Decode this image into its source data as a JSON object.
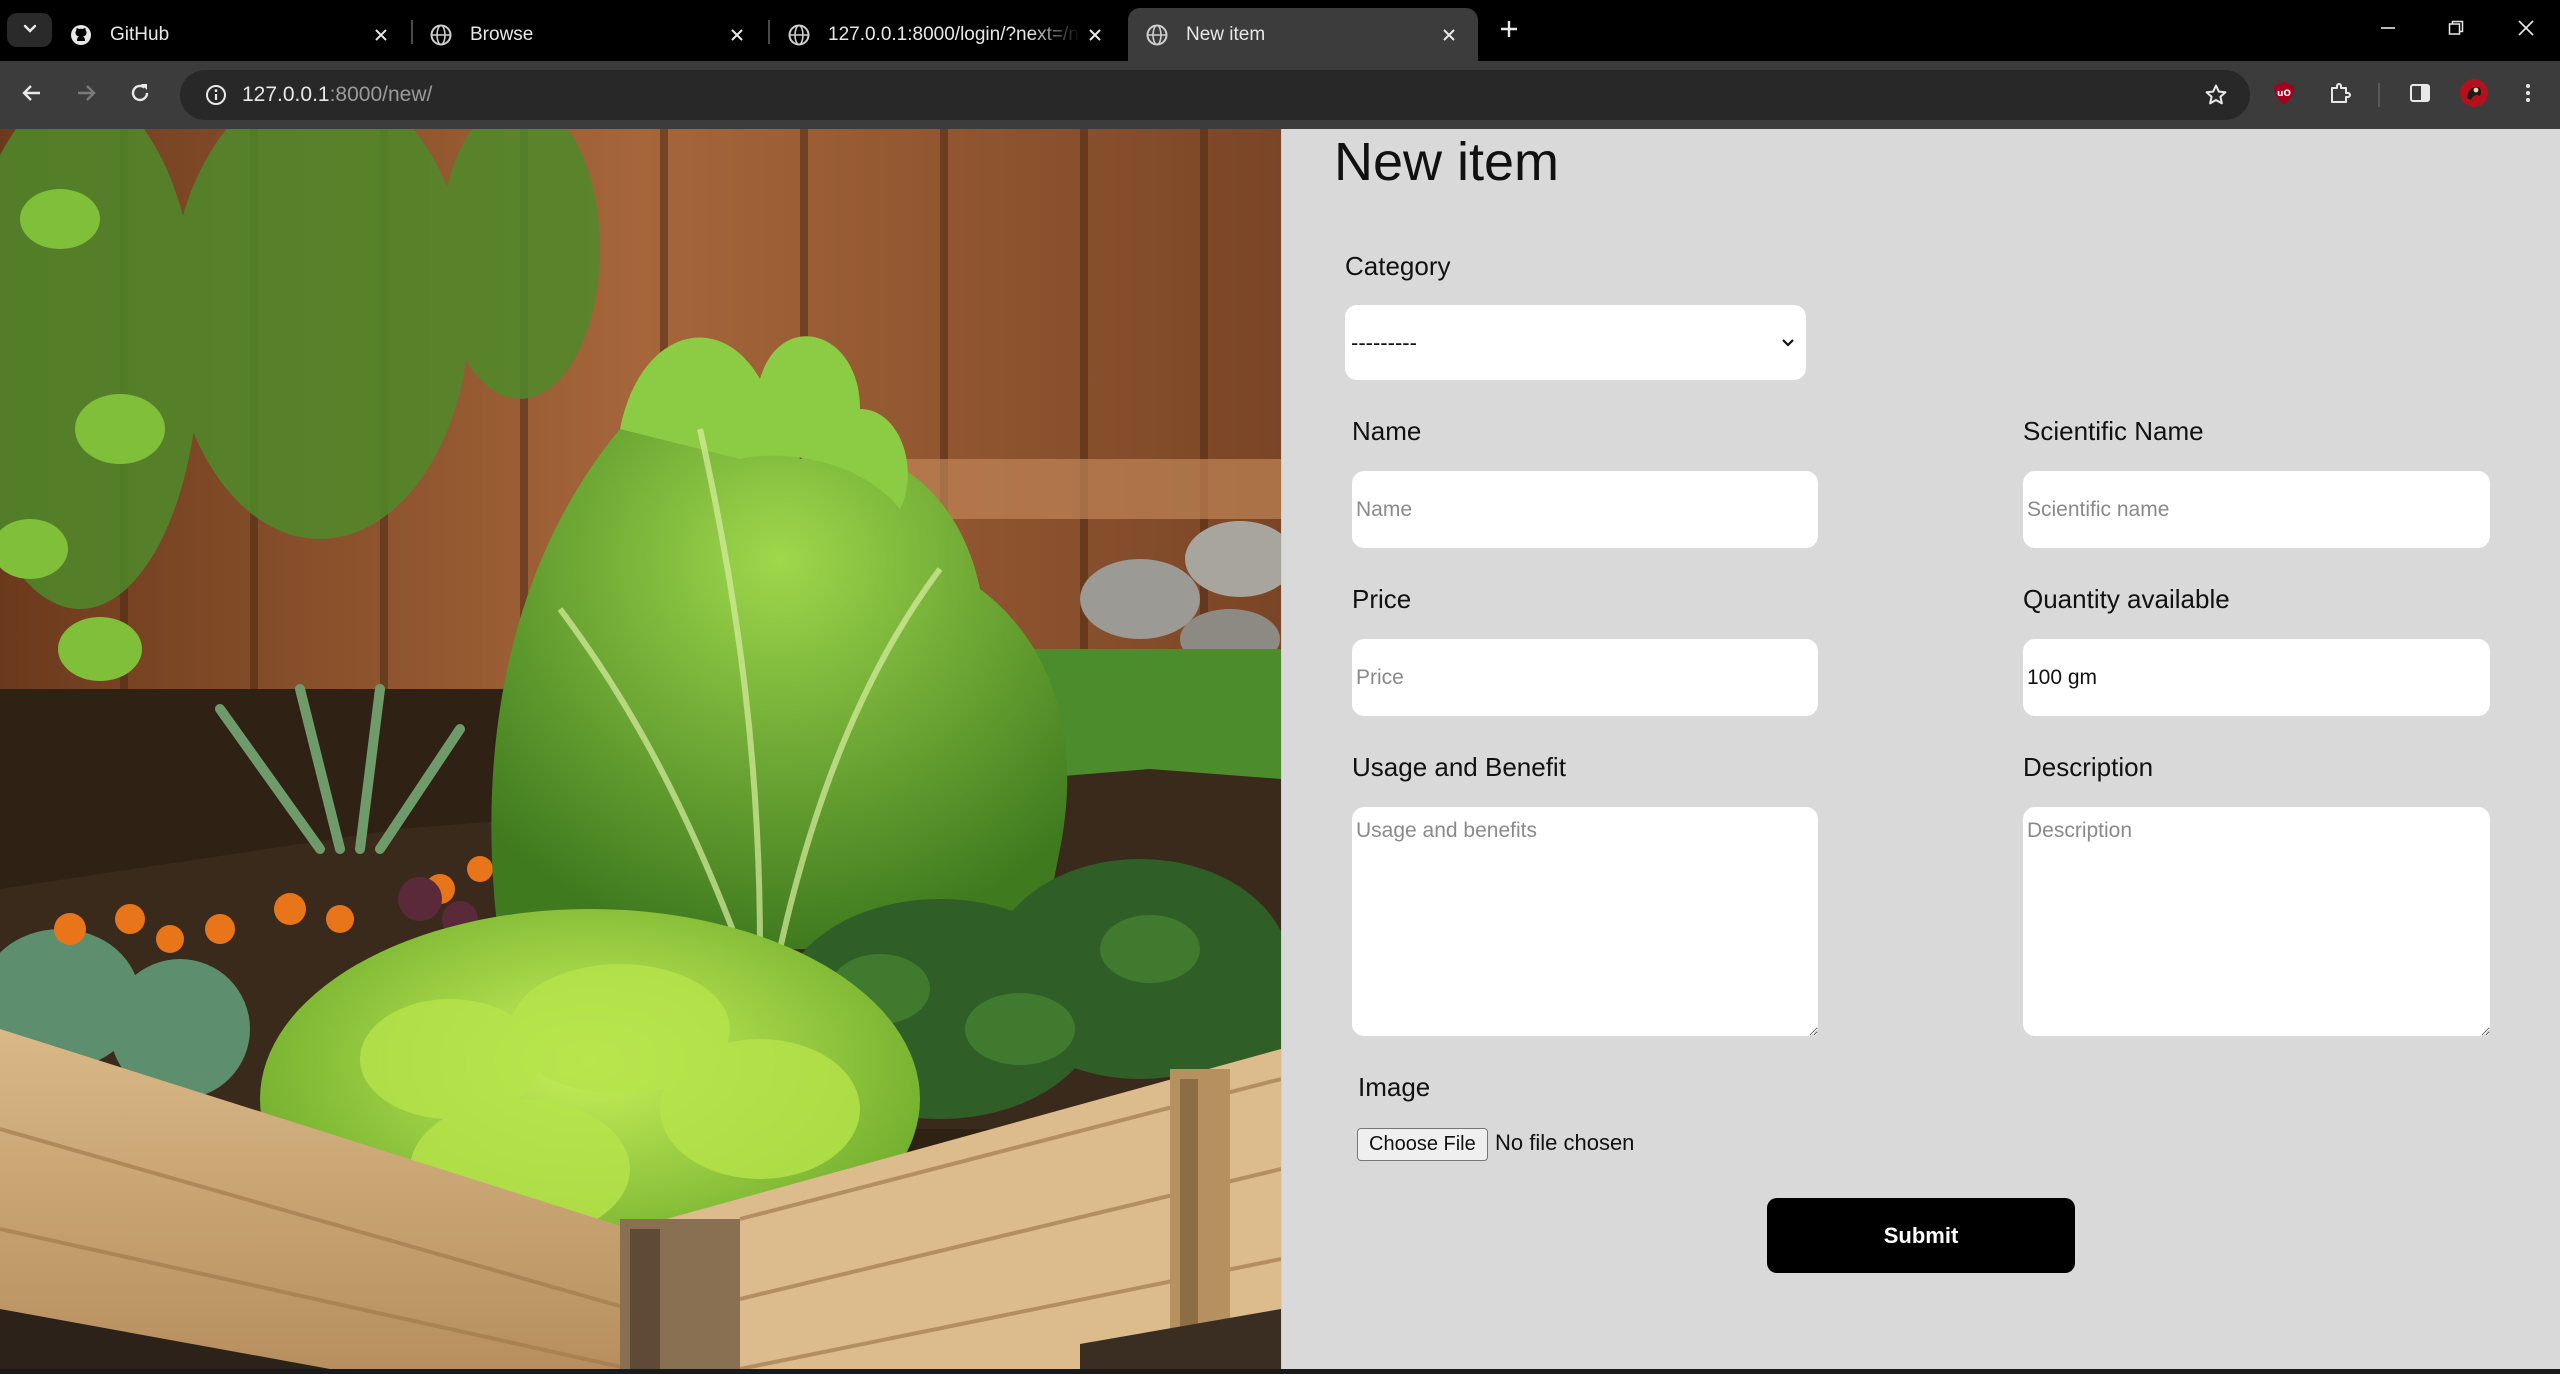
{
  "tabs": [
    {
      "title": "GitHub",
      "icon": "github-icon"
    },
    {
      "title": "Browse",
      "icon": "globe-icon"
    },
    {
      "title": "127.0.0.1:8000/login/?next=/new/",
      "icon": "globe-icon"
    },
    {
      "title": "New item",
      "icon": "globe-icon"
    }
  ],
  "address_bar": {
    "host": "127.0.0.1",
    "rest": ":8000/new/"
  },
  "page": {
    "title": "New item",
    "category": {
      "label": "Category",
      "selected": "---------"
    },
    "name": {
      "label": "Name",
      "placeholder": "Name"
    },
    "scientific_name": {
      "label": "Scientific Name",
      "placeholder": "Scientific name"
    },
    "price": {
      "label": "Price",
      "placeholder": "Price"
    },
    "quantity": {
      "label": "Quantity available",
      "value": "100 gm"
    },
    "usage": {
      "label": "Usage and Benefit",
      "placeholder": "Usage and benefits"
    },
    "description": {
      "label": "Description",
      "placeholder": "Description"
    },
    "image": {
      "label": "Image",
      "button": "Choose File",
      "status": "No file chosen"
    },
    "submit": "Submit"
  },
  "colors": {
    "chrome_bg": "#000000",
    "active_tab": "#3c3c3c",
    "form_bg": "#d9d9d9",
    "button_bg": "#000000"
  }
}
